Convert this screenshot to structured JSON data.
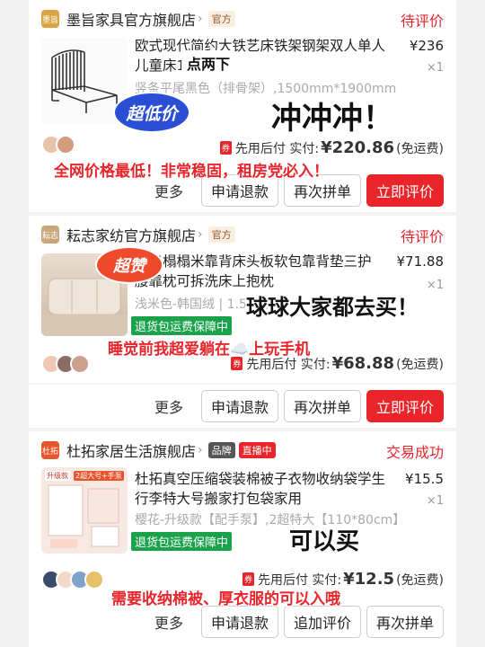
{
  "orders": [
    {
      "store": {
        "name": "墨旨家具官方旗舰店",
        "logo_text": "墨旨",
        "logo_color": "#d9a441",
        "tags": [
          "官方"
        ]
      },
      "status": "待评价",
      "product": {
        "title": "欧式现代简约大铁艺床铁架钢架双人单人儿童床1.8米",
        "price": "¥236",
        "qty": "×1",
        "spec": "竖条平尾黑色（排骨架）,1500mm*1900mm"
      },
      "payment": {
        "badge": "券",
        "label": "先用后付 实付:",
        "amount": "¥220.86",
        "note": "(免运费)"
      },
      "buttons": {
        "more": "更多",
        "refund": "申请退款",
        "rebuy": "再次拼单",
        "review": "立即评价"
      },
      "overlays": {
        "sticker": "超低价",
        "note": "点两下",
        "big_text": "冲冲冲！",
        "caption": "全网价格最低！非常稳固，租房党必入！"
      }
    },
    {
      "store": {
        "name": "耘志家纺官方旗舰店",
        "logo_text": "耘志",
        "logo_color": "#c9a77a",
        "tags": [
          "官方"
        ]
      },
      "status": "待评价",
      "product": {
        "title": "靠垫榻榻米靠背床头板软包靠背垫三护腰靠枕可拆洗床上抱枕",
        "price": "¥71.88",
        "qty": "×1",
        "spec": "浅米色-韩国绒 | 1.5米床"
      },
      "guarantee": "退货包运费保障中",
      "payment": {
        "badge": "券",
        "label": "先用后付 实付:",
        "amount": "¥68.88",
        "note": "(免运费)"
      },
      "buttons": {
        "more": "更多",
        "refund": "申请退款",
        "rebuy": "再次拼单",
        "review": "立即评价"
      },
      "overlays": {
        "sticker": "超赞",
        "big_text": "球球大家都去买！",
        "caption": "睡觉前我超爱躺在☁️上玩手机"
      }
    },
    {
      "store": {
        "name": "杜拓家居生活旗舰店",
        "logo_text": "杜拓",
        "logo_color": "#e8542b",
        "tags": [
          "品牌",
          "直播中"
        ]
      },
      "status": "交易成功",
      "product": {
        "title": "杜拓真空压缩袋装棉被子衣物收纳袋学生行李特大号搬家打包袋家用",
        "price": "¥15.5",
        "qty": "×1",
        "spec": "樱花-升级款【配手泵】,2超特大【110*80cm】"
      },
      "guarantee": "退货包运费保障中",
      "payment": {
        "badge": "券",
        "label": "先用后付 实付:",
        "amount": "¥12.5",
        "note": "(免运费)"
      },
      "buttons": {
        "more": "更多",
        "refund": "申请退款",
        "add_review": "追加评价",
        "rebuy": "再次拼单"
      },
      "overlays": {
        "big_text": "可以买",
        "caption": "需要收纳棉被、厚衣服的可以入哦",
        "thumb_label_1": "升级款",
        "thumb_label_2": "2超大号+手泵"
      }
    }
  ],
  "colors": {
    "accent": "#e8252b",
    "guarantee": "#1aa34a",
    "sticker_blue": "#2a4fd6",
    "sticker_red": "#f04a2c"
  }
}
